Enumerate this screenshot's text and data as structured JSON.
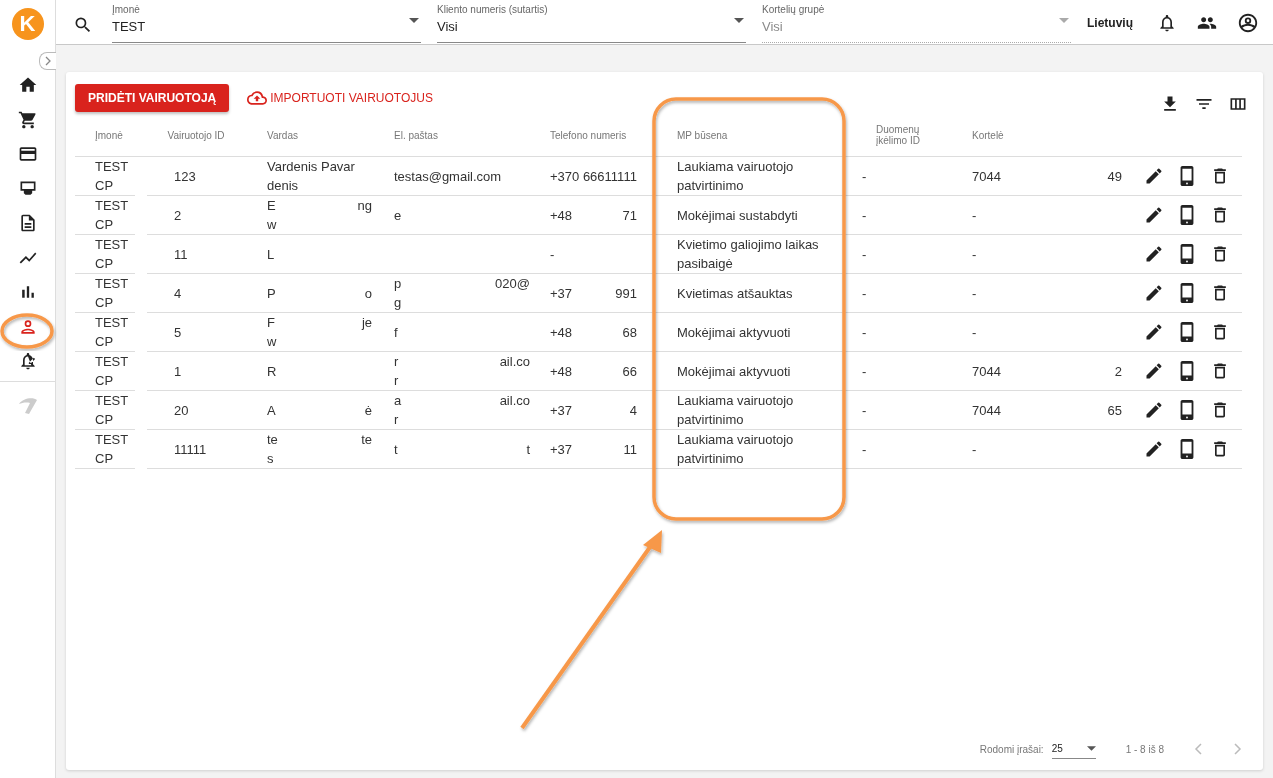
{
  "logo": {
    "letter": "K"
  },
  "sidebar": {
    "items": [
      {
        "selected": false
      },
      {
        "selected": false
      },
      {
        "selected": false
      },
      {
        "selected": false
      },
      {
        "selected": false
      },
      {
        "selected": false
      },
      {
        "selected": false
      },
      {
        "selected": true
      },
      {
        "selected": false
      }
    ]
  },
  "filters": [
    {
      "label": "Įmonė",
      "value": "TEST",
      "disabled": false
    },
    {
      "label": "Kliento numeris (sutartis)",
      "value": "Visi",
      "disabled": false
    },
    {
      "label": "Kortelių grupė",
      "value": "Visi",
      "disabled": true
    }
  ],
  "language": "Lietuvių",
  "toolbar": {
    "add_button": "PRIDĖTI VAIRUOTOJĄ",
    "import_link": "IMPORTUOTI VAIRUOTOJUS"
  },
  "table": {
    "columns": [
      "Įmonė",
      "Vairuotojo ID",
      "Vardas",
      "El. paštas",
      "Telefono numeris",
      "MP būsena",
      "Duomenų įkėlimo ID",
      "Kortelė"
    ],
    "rows": [
      {
        "company": "TEST CP",
        "id": "123",
        "name": [
          [
            "Vardenis Pavar"
          ],
          [
            "denis"
          ]
        ],
        "email": [
          [
            "testas@gmail.com"
          ]
        ],
        "phone": [
          [
            "+370 66611111"
          ]
        ],
        "status": "Laukiama vairuotojo patvirtinimo",
        "upload_id": "-",
        "card": [
          [
            "7044",
            "49"
          ]
        ]
      },
      {
        "company": "TEST CP",
        "id": "2",
        "name": [
          [
            "E",
            "ng"
          ],
          [
            "w"
          ]
        ],
        "email": [
          [
            "e"
          ]
        ],
        "phone": [
          [
            "+48",
            "71"
          ]
        ],
        "status": "Mokėjimai sustabdyti",
        "upload_id": "-",
        "card": [
          [
            "-"
          ]
        ]
      },
      {
        "company": "TEST CP",
        "id": "11",
        "name": [
          [
            "L"
          ]
        ],
        "phone": [
          [
            "-"
          ]
        ],
        "status": "Kvietimo galiojimo laikas pasibaigė",
        "upload_id": "-",
        "card": [
          [
            "-"
          ]
        ]
      },
      {
        "company": "TEST CP",
        "id": "4",
        "name": [
          [
            "P",
            "o"
          ]
        ],
        "email": [
          [
            "p",
            "020@"
          ],
          [
            "g"
          ]
        ],
        "phone": [
          [
            "+37",
            "991"
          ]
        ],
        "status": "Kvietimas atšauktas",
        "upload_id": "-",
        "card": [
          [
            "-"
          ]
        ]
      },
      {
        "company": "TEST CP",
        "id": "5",
        "name": [
          [
            "F",
            "je"
          ],
          [
            "w"
          ]
        ],
        "email": [
          [
            "f"
          ]
        ],
        "phone": [
          [
            "+48",
            "68"
          ]
        ],
        "status": "Mokėjimai aktyvuoti",
        "upload_id": "-",
        "card": [
          [
            "-"
          ]
        ]
      },
      {
        "company": "TEST CP",
        "id": "1",
        "name": [
          [
            "R"
          ]
        ],
        "email": [
          [
            "r",
            "ail.co"
          ],
          [
            "r"
          ]
        ],
        "phone": [
          [
            "+48",
            "66"
          ]
        ],
        "status": "Mokėjimai aktyvuoti",
        "upload_id": "-",
        "card": [
          [
            "7044",
            "2"
          ]
        ]
      },
      {
        "company": "TEST CP",
        "id": "20",
        "name": [
          [
            "A",
            "ė"
          ]
        ],
        "email": [
          [
            "a",
            "ail.co"
          ],
          [
            "r"
          ]
        ],
        "phone": [
          [
            "+37",
            "4"
          ]
        ],
        "status": "Laukiama vairuotojo patvirtinimo",
        "upload_id": "-",
        "card": [
          [
            "7044",
            "65"
          ]
        ]
      },
      {
        "company": "TEST CP",
        "id": "11111",
        "name": [
          [
            "te",
            "te"
          ],
          [
            "s"
          ]
        ],
        "email": [
          [
            "t",
            "t"
          ]
        ],
        "phone": [
          [
            "+37",
            "11"
          ]
        ],
        "status": "Laukiama vairuotojo patvirtinimo",
        "upload_id": "-",
        "card": [
          [
            "-"
          ]
        ]
      }
    ]
  },
  "pagination": {
    "label": "Rodomi įrašai:",
    "page_size": "25",
    "range": "1 - 8 iš 8"
  }
}
